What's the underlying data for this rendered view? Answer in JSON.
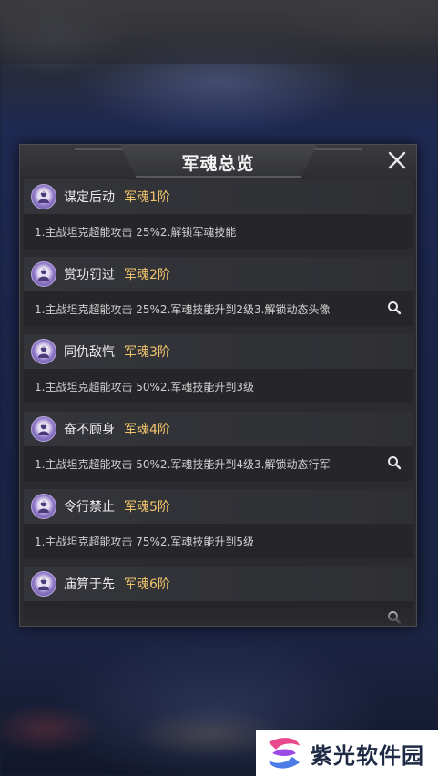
{
  "panel": {
    "title": "军魂总览",
    "close_icon": "close-icon"
  },
  "items": [
    {
      "name": "谋定后动",
      "level": "军魂1阶",
      "desc": "1.主战坦克超能攻击 25%2.解锁军魂技能",
      "has_search": false
    },
    {
      "name": "赏功罚过",
      "level": "军魂2阶",
      "desc": "1.主战坦克超能攻击 25%2.军魂技能升到2级3.解锁动态头像",
      "has_search": true
    },
    {
      "name": "同仇敌忾",
      "level": "军魂3阶",
      "desc": "1.主战坦克超能攻击 50%2.军魂技能升到3级",
      "has_search": false
    },
    {
      "name": "奋不顾身",
      "level": "军魂4阶",
      "desc": "1.主战坦克超能攻击 50%2.军魂技能升到4级3.解锁动态行军",
      "has_search": true
    },
    {
      "name": "令行禁止",
      "level": "军魂5阶",
      "desc": "1.主战坦克超能攻击 75%2.军魂技能升到5级",
      "has_search": false
    },
    {
      "name": "庙算于先",
      "level": "军魂6阶",
      "desc": "",
      "has_search": true
    }
  ],
  "watermark": {
    "text": "紫光软件园"
  },
  "colors": {
    "level": "#f0c46a",
    "badge": "#8f79c8",
    "panel": "#2c2c30"
  }
}
